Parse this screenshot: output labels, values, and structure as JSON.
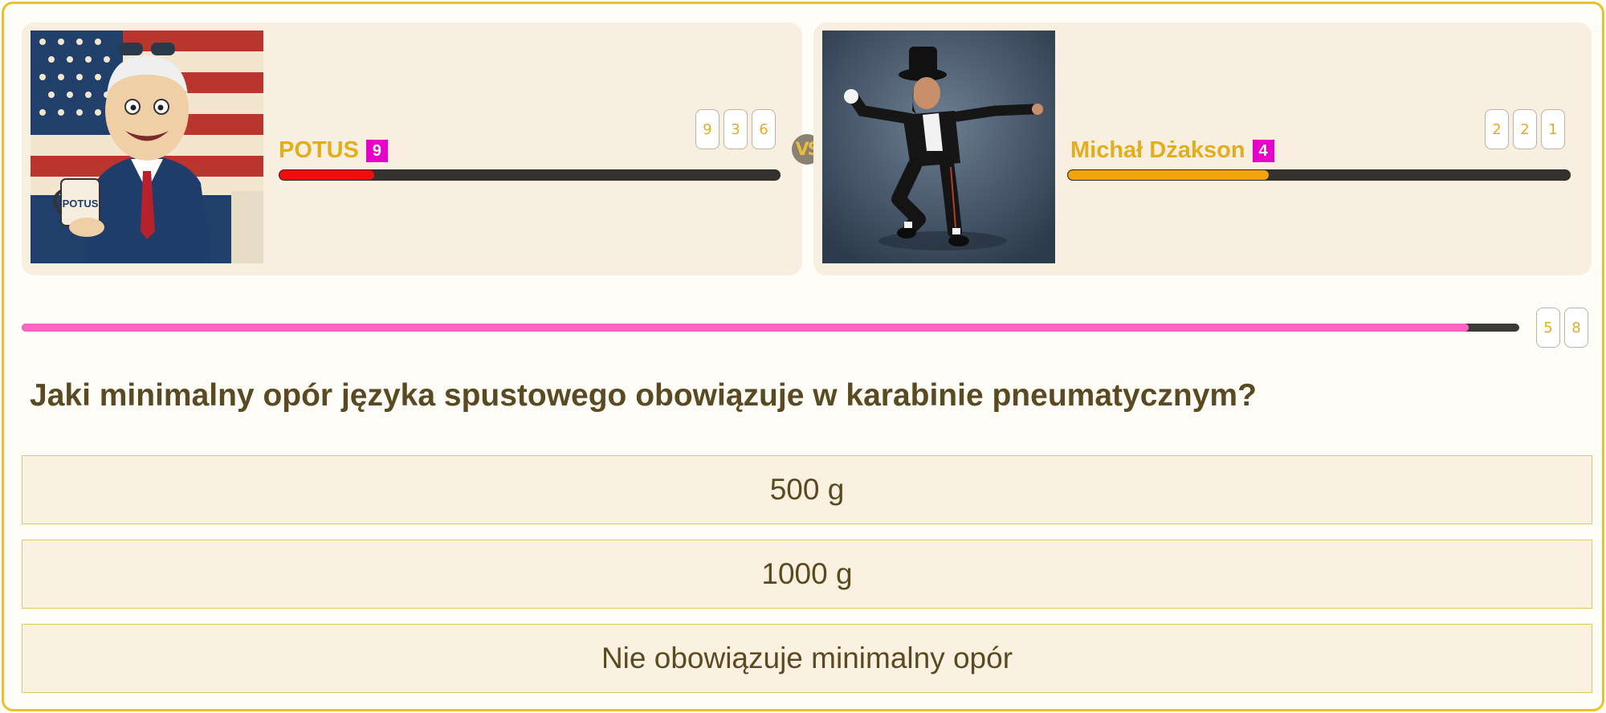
{
  "players": [
    {
      "name": "POTUS",
      "level": "9",
      "score_digits": [
        "9",
        "3",
        "6"
      ],
      "hp_fraction": 0.19,
      "hp_color": "#f20d0d",
      "avatar": "potus-cartoon-portrait",
      "mug_text": "POTUS"
    },
    {
      "name": "Michał Dżakson",
      "level": "4",
      "score_digits": [
        "2",
        "2",
        "1"
      ],
      "hp_fraction": 0.4,
      "hp_color": "#f3a40d",
      "avatar": "dancer-portrait"
    }
  ],
  "vs_label": "VS",
  "timer": {
    "fraction_remaining": 0.966,
    "digits": [
      "5",
      "8"
    ],
    "color": "#ff63c3"
  },
  "question": "Jaki minimalny opór języka spustowego obowiązuje w karabinie pneumatycznym?",
  "answers": [
    {
      "label": "500 g"
    },
    {
      "label": "1000 g"
    },
    {
      "label": "Nie obowiązuje minimalny opór"
    }
  ]
}
